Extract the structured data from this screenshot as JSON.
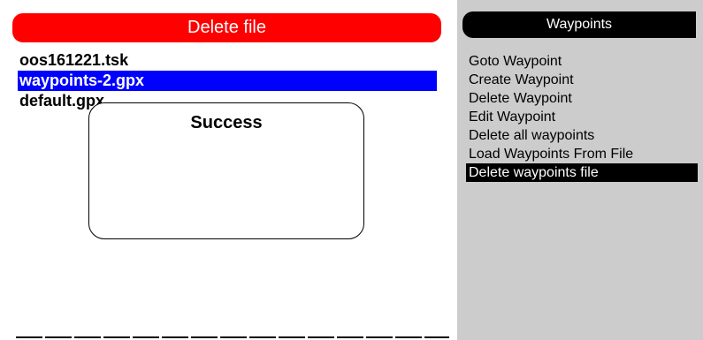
{
  "colors": {
    "header_red": "#ff0000",
    "selection_blue": "#0000ff",
    "right_panel_bg": "#cccccc"
  },
  "delete_file": {
    "title": "Delete file",
    "files": [
      {
        "name": "oos161221.tsk",
        "selected": false
      },
      {
        "name": "waypoints-2.gpx",
        "selected": true
      },
      {
        "name": "default.gpx",
        "selected": false
      }
    ]
  },
  "dialog": {
    "message": "Success"
  },
  "waypoints_menu": {
    "title": "Waypoints",
    "items": [
      {
        "label": "Goto Waypoint",
        "selected": false
      },
      {
        "label": "Create Waypoint",
        "selected": false
      },
      {
        "label": "Delete Waypoint",
        "selected": false
      },
      {
        "label": "Edit Waypoint",
        "selected": false
      },
      {
        "label": "Delete all waypoints",
        "selected": false
      },
      {
        "label": "Load Waypoints From File",
        "selected": false
      },
      {
        "label": "Delete waypoints file",
        "selected": true
      }
    ]
  }
}
